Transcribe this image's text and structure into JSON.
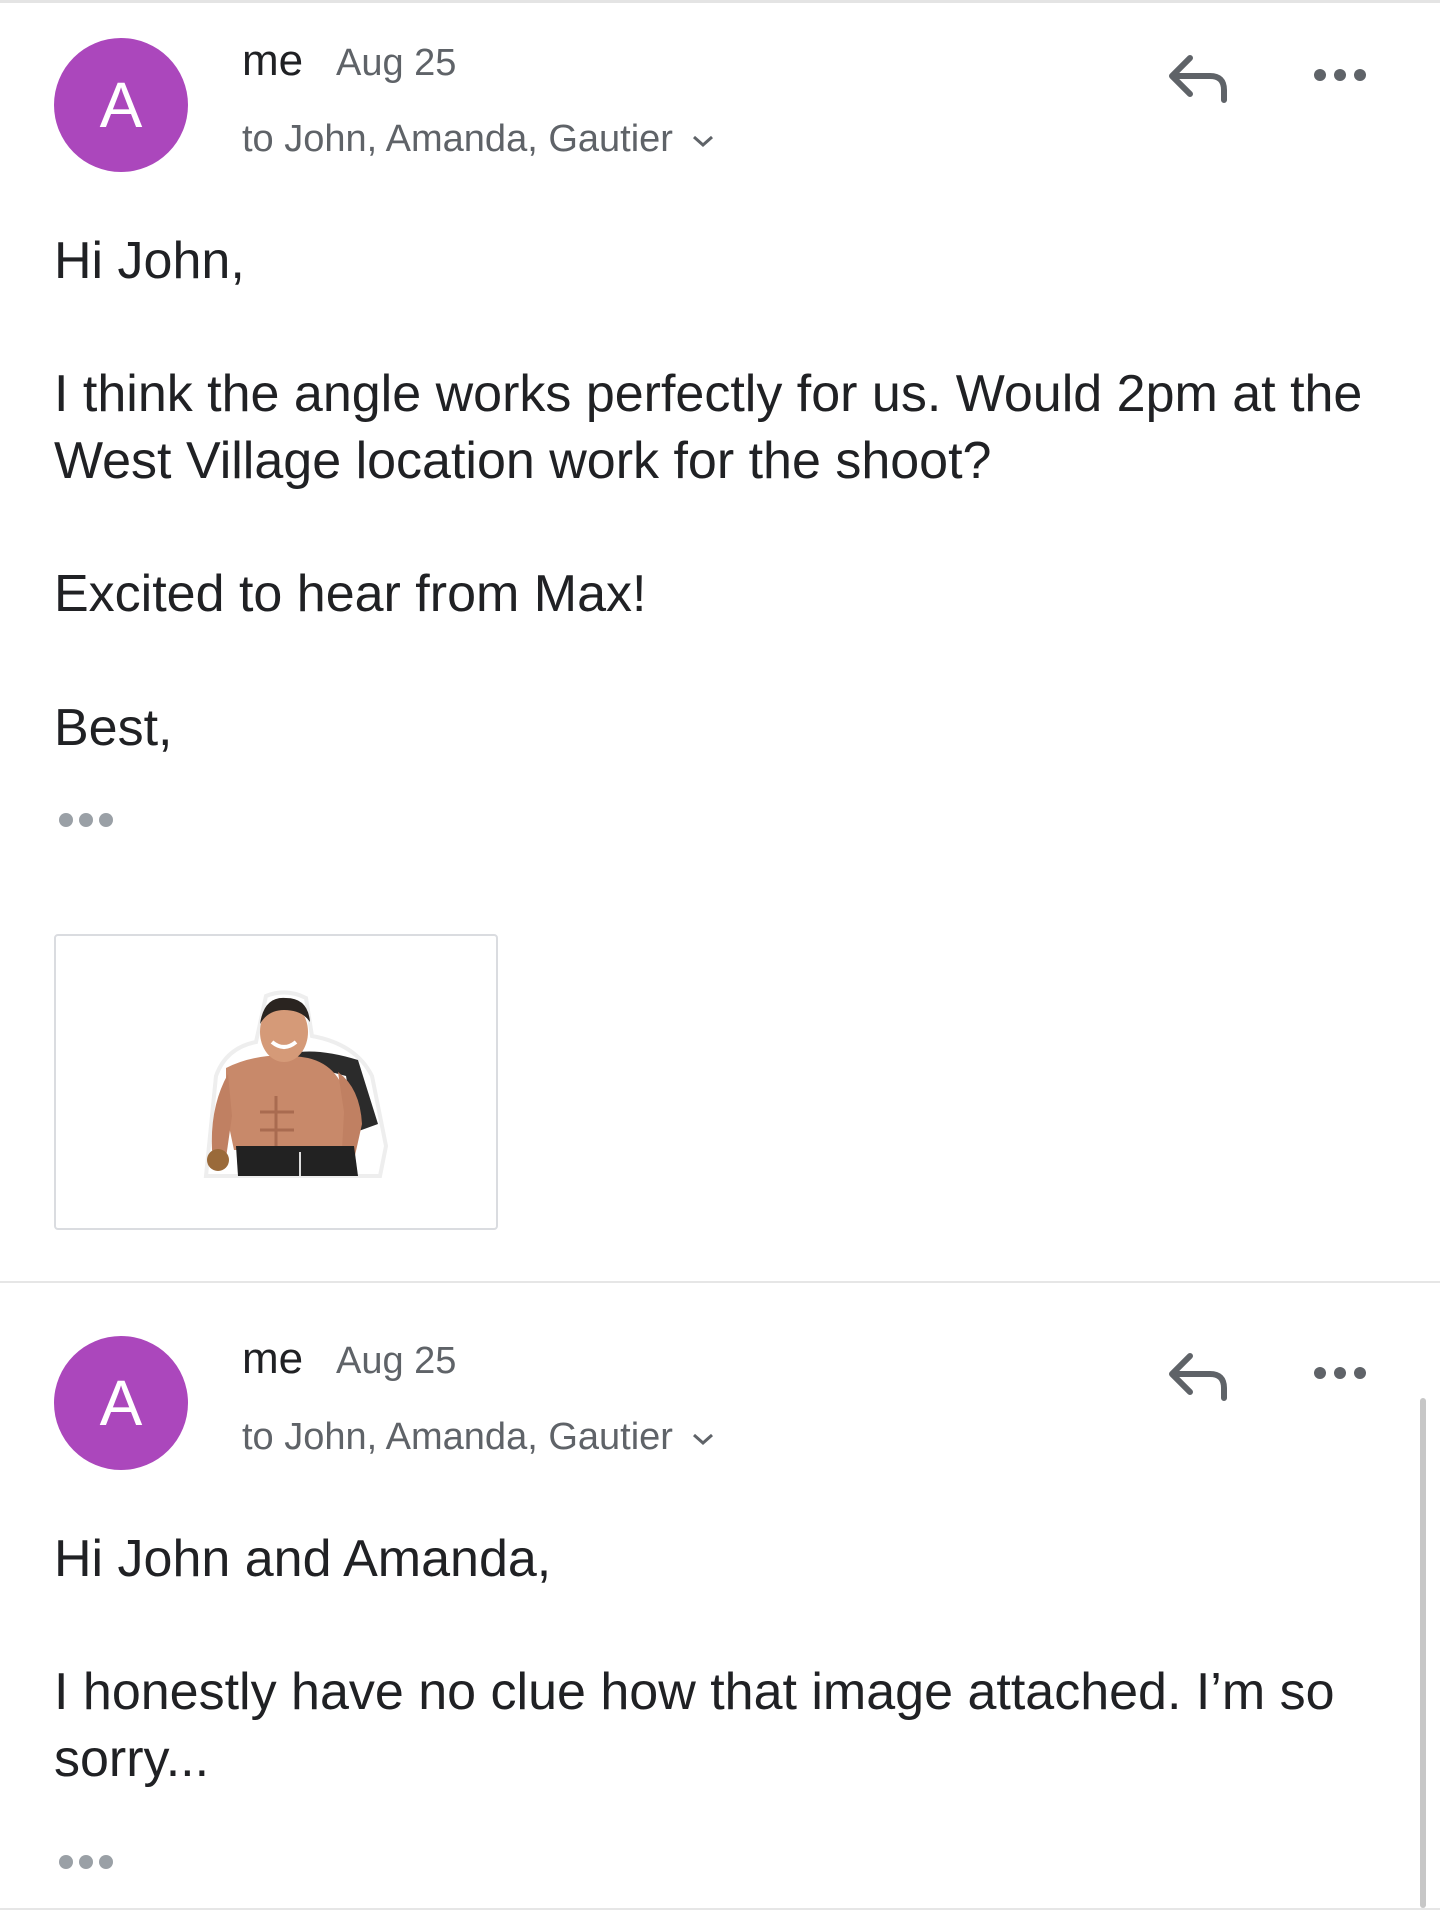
{
  "messages": [
    {
      "avatar_letter": "A",
      "sender": "me",
      "date": "Aug 25",
      "recipients": "to John, Amanda, Gautier",
      "paragraphs": [
        "Hi John,",
        "I think the angle works perfectly for us. Would 2pm at the West Village location work for the shoot?",
        "Excited to hear from Max!",
        "Best,"
      ],
      "has_attachment": true
    },
    {
      "avatar_letter": "A",
      "sender": "me",
      "date": "Aug 25",
      "recipients": "to John, Amanda, Gautier",
      "paragraphs": [
        "Hi John and Amanda,",
        "I honestly have no clue how that image attached. I’m so sorry..."
      ],
      "has_attachment": false
    }
  ],
  "colors": {
    "avatar": "#ab47bc",
    "text": "#202124",
    "secondary_text": "#5f6368",
    "icon": "#5f6368",
    "trim_dots": "#9aa0a6"
  },
  "icons": [
    "reply-icon",
    "more-options-icon",
    "chevron-down-icon",
    "show-trimmed-content-icon"
  ]
}
